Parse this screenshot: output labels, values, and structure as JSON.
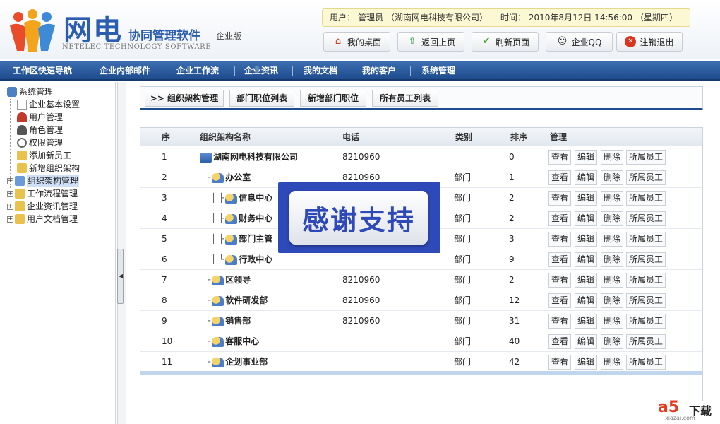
{
  "brand": {
    "name_cn": "网电",
    "product": "协同管理软件",
    "edition": "企业版",
    "name_en": "NETELEC TECHNOLOGY SOFTWARE"
  },
  "info": {
    "user_label": "用户：",
    "user_value": "管理员",
    "company": "（湖南网电科技有限公司）",
    "time_label": "时间：",
    "time_value": "2010年8月12日 14:56:00",
    "weekday": "（星期四）"
  },
  "top_buttons": [
    {
      "label": "我的桌面",
      "icon": "home-icon"
    },
    {
      "label": "返回上页",
      "icon": "back-arrow-icon"
    },
    {
      "label": "刷新页面",
      "icon": "check-icon"
    },
    {
      "label": "企业QQ",
      "icon": "qq-icon"
    },
    {
      "label": "注销退出",
      "icon": "logout-icon"
    }
  ],
  "nav": [
    "工作区快速导航",
    "企业内部邮件",
    "企业工作流",
    "企业资讯",
    "我的文档",
    "我的客户",
    "系统管理"
  ],
  "sidebar": {
    "root": "系统管理",
    "children": [
      "企业基本设置",
      "用户管理",
      "角色管理",
      "权限管理",
      "添加新员工",
      "新增组织架构",
      "组织架构管理"
    ],
    "groups": [
      "工作流程管理",
      "企业资讯管理",
      "用户文档管理"
    ],
    "selected": "组织架构管理"
  },
  "tabs": [
    ">> 组织架构管理",
    "部门职位列表",
    "新增部门职位",
    "所有员工列表"
  ],
  "table": {
    "headers": [
      "序",
      "组织架构名称",
      "电话",
      "类别",
      "排序",
      "管理"
    ],
    "rows": [
      {
        "no": "1",
        "prefix": "",
        "name": "湖南网电科技有限公司",
        "phone": "8210960",
        "type": "",
        "order": "0"
      },
      {
        "no": "2",
        "prefix": "├",
        "name": "办公室",
        "phone": "8210960",
        "type": "部门",
        "order": "1"
      },
      {
        "no": "3",
        "prefix": "│ ├",
        "name": "信息中心",
        "phone": "",
        "type": "部门",
        "order": "2"
      },
      {
        "no": "4",
        "prefix": "│ ├",
        "name": "财务中心",
        "phone": "",
        "type": "部门",
        "order": "2"
      },
      {
        "no": "5",
        "prefix": "│ ├",
        "name": "部门主管",
        "phone": "",
        "type": "部门",
        "order": "3"
      },
      {
        "no": "6",
        "prefix": "│ └",
        "name": "行政中心",
        "phone": "",
        "type": "部门",
        "order": "9"
      },
      {
        "no": "7",
        "prefix": "├",
        "name": "区领导",
        "phone": "8210960",
        "type": "部门",
        "order": "2"
      },
      {
        "no": "8",
        "prefix": "├",
        "name": "软件研发部",
        "phone": "8210960",
        "type": "部门",
        "order": "12"
      },
      {
        "no": "9",
        "prefix": "├",
        "name": "销售部",
        "phone": "8210960",
        "type": "部门",
        "order": "31"
      },
      {
        "no": "10",
        "prefix": "├",
        "name": "客服中心",
        "phone": "",
        "type": "部门",
        "order": "40"
      },
      {
        "no": "11",
        "prefix": "└",
        "name": "企划事业部",
        "phone": "",
        "type": "部门",
        "order": "42"
      }
    ],
    "actions": [
      "查看",
      "编辑",
      "删除",
      "所属员工"
    ]
  },
  "overlay": {
    "text": "感谢支持"
  },
  "watermark": {
    "logo": "a5",
    "label": "下载",
    "url": "xiazai.com"
  },
  "colors": {
    "nav": "#1e4c8e",
    "accent": "#2a5db0",
    "overlay": "#2e49b8",
    "info_bar": "#fdf8d4"
  }
}
